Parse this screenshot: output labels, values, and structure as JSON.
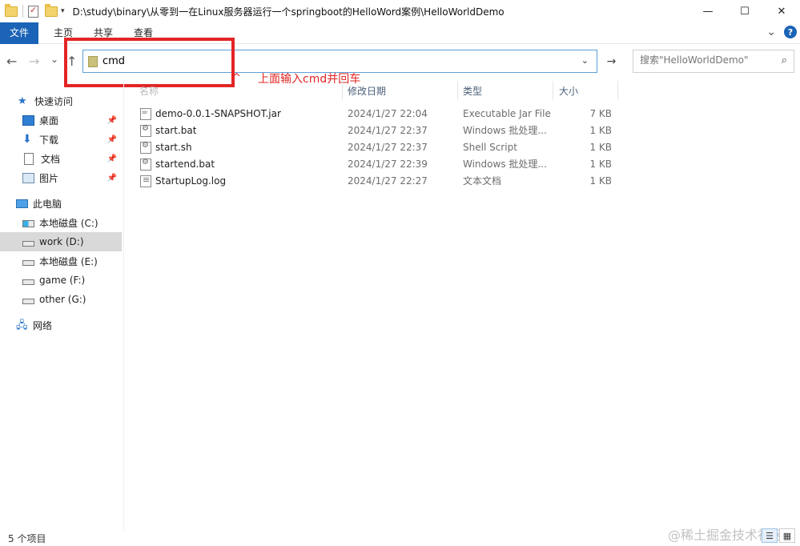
{
  "window": {
    "title_path": "D:\\study\\binary\\从零到一在Linux服务器运行一个springboot的HelloWord案例\\HelloWorldDemo",
    "controls": {
      "minimize": "—",
      "maximize": "☐",
      "close": "✕"
    }
  },
  "ribbon": {
    "tabs": [
      "文件",
      "主页",
      "共享",
      "查看"
    ],
    "expand_icon": "⌄",
    "help_icon": "?"
  },
  "nav": {
    "back": "←",
    "forward": "→",
    "recent": "⌄",
    "up": "↑",
    "address_value": "cmd",
    "address_dropdown": "⌄",
    "go": "→",
    "search_placeholder": "搜索\"HelloWorldDemo\"",
    "search_icon": "⌕"
  },
  "annotation": {
    "caret": "^",
    "text": "上面输入cmd并回车",
    "color": "#e32525"
  },
  "sidebar": {
    "quick_access": "快速访问",
    "pinned": [
      {
        "label": "桌面",
        "icon": "desktop-icon"
      },
      {
        "label": "下载",
        "icon": "download-icon"
      },
      {
        "label": "文档",
        "icon": "document-icon"
      },
      {
        "label": "图片",
        "icon": "pictures-icon"
      }
    ],
    "pin_glyph": "📌",
    "this_pc": "此电脑",
    "drives": [
      {
        "label": "本地磁盘 (C:)",
        "selected": false
      },
      {
        "label": "work (D:)",
        "selected": true
      },
      {
        "label": "本地磁盘 (E:)",
        "selected": false
      },
      {
        "label": "game (F:)",
        "selected": false
      },
      {
        "label": "other (G:)",
        "selected": false
      }
    ],
    "network": "网络"
  },
  "columns": {
    "name": "名称",
    "date": "修改日期",
    "type": "类型",
    "size": "大小"
  },
  "files": [
    {
      "name": "demo-0.0.1-SNAPSHOT.jar",
      "date": "2024/1/27 22:04",
      "type": "Executable Jar File",
      "size": "7 KB",
      "icon": "jar"
    },
    {
      "name": "start.bat",
      "date": "2024/1/27 22:37",
      "type": "Windows 批处理...",
      "size": "1 KB",
      "icon": "gear"
    },
    {
      "name": "start.sh",
      "date": "2024/1/27 22:37",
      "type": "Shell Script",
      "size": "1 KB",
      "icon": "gear"
    },
    {
      "name": "startend.bat",
      "date": "2024/1/27 22:39",
      "type": "Windows 批处理...",
      "size": "1 KB",
      "icon": "gear"
    },
    {
      "name": "StartupLog.log",
      "date": "2024/1/27 22:27",
      "type": "文本文档",
      "size": "1 KB",
      "icon": "log"
    }
  ],
  "status": {
    "item_count": "5 个项目"
  },
  "view_buttons": {
    "details": "☰",
    "large_icons": "▦"
  },
  "watermark": "@稀土掘金技术社区"
}
